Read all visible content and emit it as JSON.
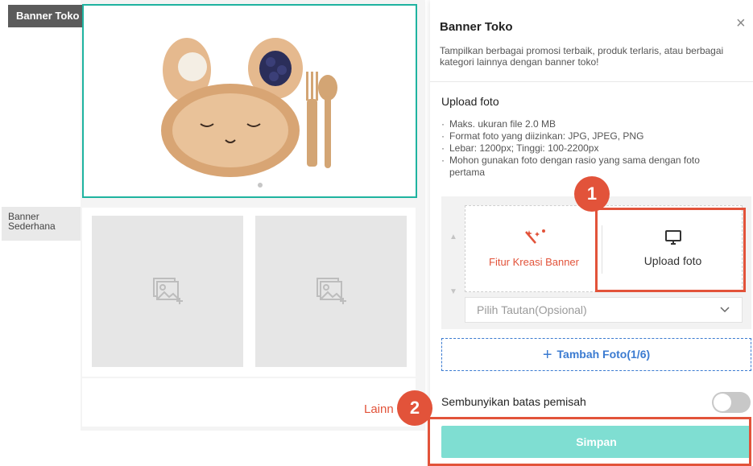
{
  "left": {
    "tag_banner_toko": "Banner Toko",
    "tag_banner_sederhana": "Banner Sederhana",
    "lainnya_label": "Lainn"
  },
  "panel": {
    "title": "Banner Toko",
    "close": "×",
    "description": "Tampilkan berbagai promosi terbaik, produk terlaris, atau berbagai kategori lainnya dengan banner toko!",
    "upload_heading": "Upload foto",
    "rules": [
      "Maks. ukuran file 2.0 MB",
      "Format foto yang diizinkan: JPG, JPEG, PNG",
      "Lebar: 1200px; Tinggi: 100-2200px",
      "Mohon gunakan foto dengan rasio yang sama dengan foto pertama"
    ],
    "fitur_label": "Fitur Kreasi Banner",
    "upload_label": "Upload foto",
    "select_placeholder": "Pilih Tautan(Opsional)",
    "tambah_label": "Tambah Foto(1/6)",
    "hide_label": "Sembunyikan batas pemisah",
    "toggle_on": false,
    "save_label": "Simpan"
  },
  "annotations": {
    "badge1": "1",
    "badge2": "2"
  },
  "colors": {
    "accent": "#e2533a",
    "teal": "#1fb3a0",
    "save_bg": "#7fded2",
    "link_blue": "#3b7bd1"
  }
}
